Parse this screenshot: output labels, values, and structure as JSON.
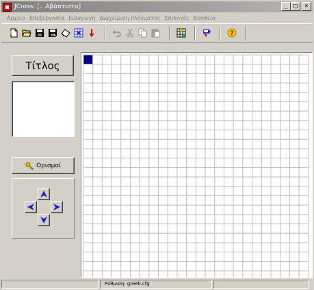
{
  "window": {
    "title": "JCross: [...Αβάπτιστο]",
    "minimize": "_",
    "maximize": "□",
    "close": "×"
  },
  "menu": [
    "Αρχείο",
    "Επεξεργασία",
    "Εισαγωγή",
    "Διαχείριση πλέγματος",
    "Επιλογές",
    "Βοήθεια"
  ],
  "toolbar": {
    "groups": [
      [
        "new-icon",
        "open-icon",
        "save-icon",
        "save-as-icon",
        "eraser-icon",
        "grid-pattern-icon",
        "import-arrow-icon"
      ],
      [
        "undo-icon",
        "cut-icon",
        "copy-icon",
        "paste-icon"
      ],
      [
        "grid-settings-icon"
      ],
      [
        "web-export-icon"
      ],
      [
        "help-icon"
      ]
    ]
  },
  "left_panel": {
    "title_button": "Τίτλος",
    "definitions_button": "Ορισμοί",
    "key_icon": "key-icon"
  },
  "grid": {
    "rows": 24,
    "cols": 24,
    "selected_row": 0,
    "selected_col": 0,
    "selected_color": "#000080",
    "line_color": "#c0c0c0"
  },
  "status": {
    "left": "",
    "config": "Ρύθμιση: greek.cfg",
    "right": ""
  },
  "colors": {
    "face": "#d4d0c8",
    "accent_blue": "#1a20c8"
  }
}
